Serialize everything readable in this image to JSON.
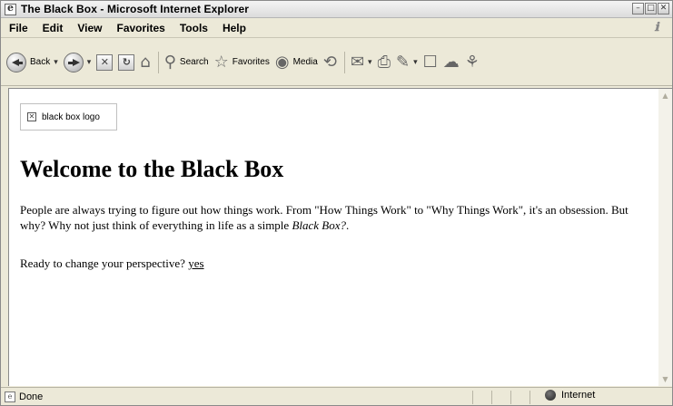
{
  "window": {
    "title": "The Black Box - Microsoft Internet Explorer",
    "controls": [
      "minimize",
      "maximize",
      "close"
    ]
  },
  "menu": {
    "items": [
      {
        "label": "File"
      },
      {
        "label": "Edit"
      },
      {
        "label": "View"
      },
      {
        "label": "Favorites"
      },
      {
        "label": "Tools"
      },
      {
        "label": "Help"
      }
    ]
  },
  "toolbar": {
    "back_label": "Back",
    "search_label": "Search",
    "favorites_label": "Favorites",
    "media_label": "Media"
  },
  "page": {
    "logo_alt": "black box logo",
    "heading": "Welcome to the Black Box",
    "paragraph_main": "People are always trying to figure out how things work. From \"How Things Work\" to \"Why Things Work\", it's an obsession. But why? Why not just think of everything in life as a simple ",
    "paragraph_emphasis": "Black Box?",
    "paragraph_end": ".",
    "question": "Ready to change your perspective? ",
    "link_text": "yes"
  },
  "status": {
    "text": "Done",
    "zone": "Internet"
  }
}
